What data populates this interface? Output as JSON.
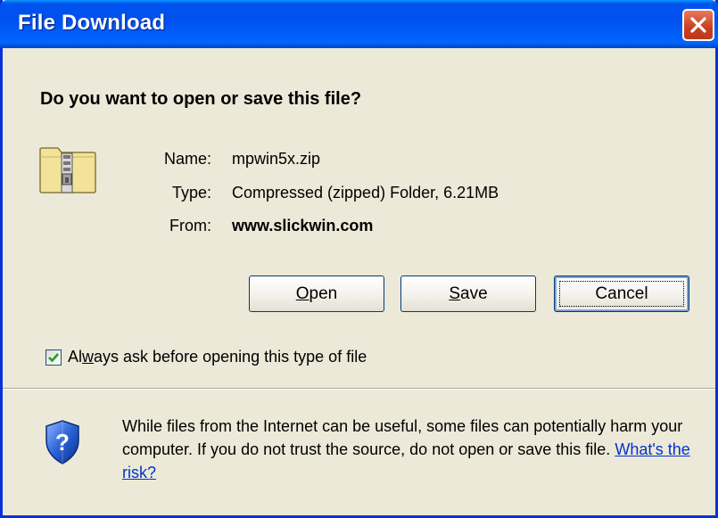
{
  "window": {
    "title": "File Download"
  },
  "dialog": {
    "question": "Do you want to open or save this file?",
    "name_label": "Name:",
    "name_value": "mpwin5x.zip",
    "type_label": "Type:",
    "type_value": "Compressed (zipped) Folder, 6.21MB",
    "from_label": "From:",
    "from_value": "www.slickwin.com"
  },
  "buttons": {
    "open": {
      "mnemonic": "O",
      "rest": "pen"
    },
    "save": {
      "mnemonic": "S",
      "rest": "ave"
    },
    "cancel": "Cancel"
  },
  "checkbox": {
    "label_pre": "Al",
    "label_mnemonic": "w",
    "label_post": "ays ask before opening this type of file",
    "checked": true
  },
  "warning": {
    "text": "While files from the Internet can be useful, some files can potentially harm your computer. If you do not trust the source, do not open or save this file. ",
    "link": "What's the risk?"
  },
  "icons": {
    "close": "close-icon",
    "file": "zip-folder-icon",
    "shield": "security-shield-icon"
  },
  "colors": {
    "titlebar": "#0054e3",
    "dialog_bg": "#ece9d8",
    "close_button": "#c9401d",
    "link": "#0033cc"
  }
}
